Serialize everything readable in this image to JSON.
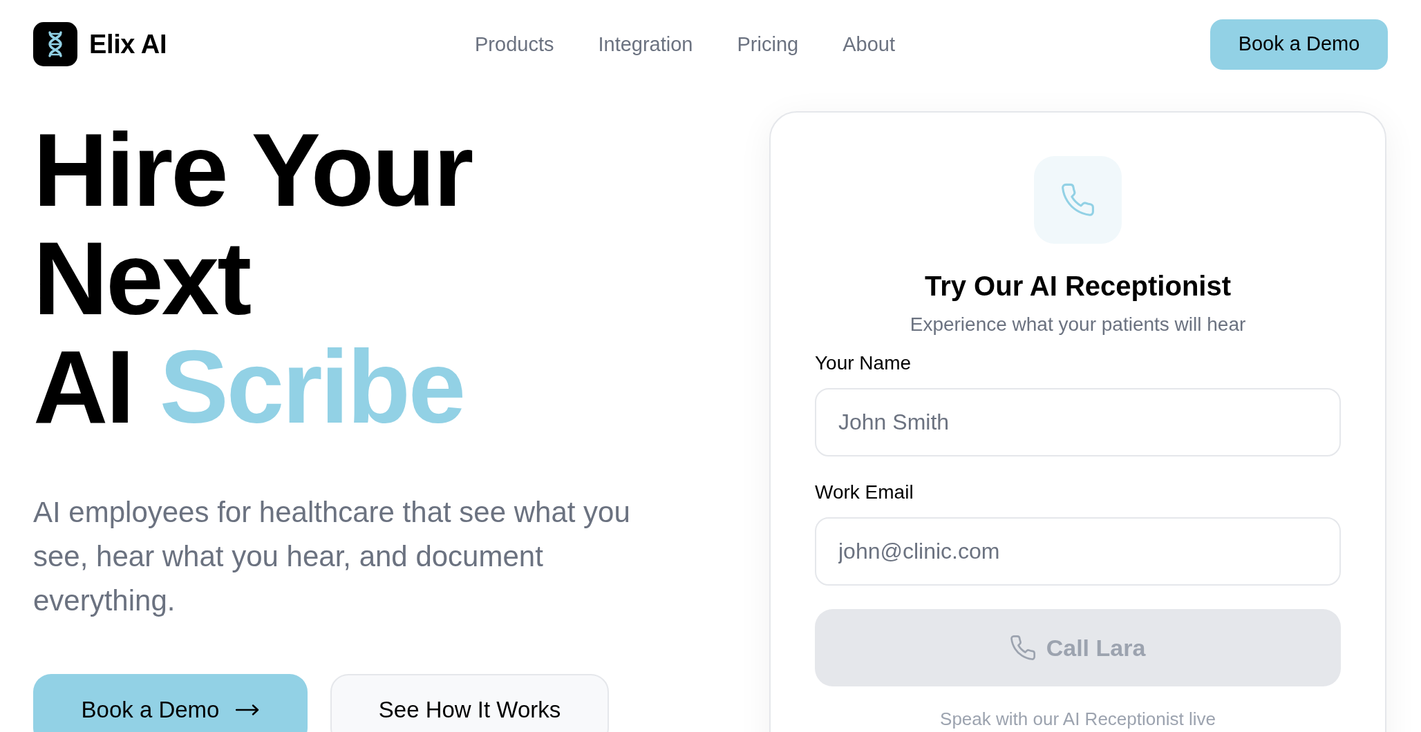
{
  "header": {
    "brand": "Elix AI",
    "nav": [
      {
        "label": "Products"
      },
      {
        "label": "Integration"
      },
      {
        "label": "Pricing"
      },
      {
        "label": "About"
      }
    ],
    "cta": "Book a Demo"
  },
  "hero": {
    "headline": [
      {
        "segments": [
          {
            "text": "Hire Your",
            "accent": false
          }
        ]
      },
      {
        "segments": [
          {
            "text": "Next",
            "accent": false
          }
        ]
      },
      {
        "segments": [
          {
            "text": "AI",
            "accent": false
          },
          {
            "text": "Scribe",
            "accent": true
          }
        ]
      }
    ],
    "description": "AI employees for healthcare that see what you see, hear what you hear, and document everything.",
    "buttons": [
      {
        "label": "Book a Demo",
        "kind": "primary"
      },
      {
        "label": "See How It Works",
        "kind": "secondary"
      }
    ]
  },
  "demo_card": {
    "title": "Try Our AI Receptionist",
    "subtitle": "Experience what your patients will hear",
    "fields": [
      {
        "label": "Your Name",
        "placeholder": "John Smith"
      },
      {
        "label": "Work Email",
        "placeholder": "john@clinic.com"
      }
    ],
    "call_button": {
      "label": "Call Lara",
      "disabled": true
    },
    "note": "Speak with our AI Receptionist live"
  }
}
